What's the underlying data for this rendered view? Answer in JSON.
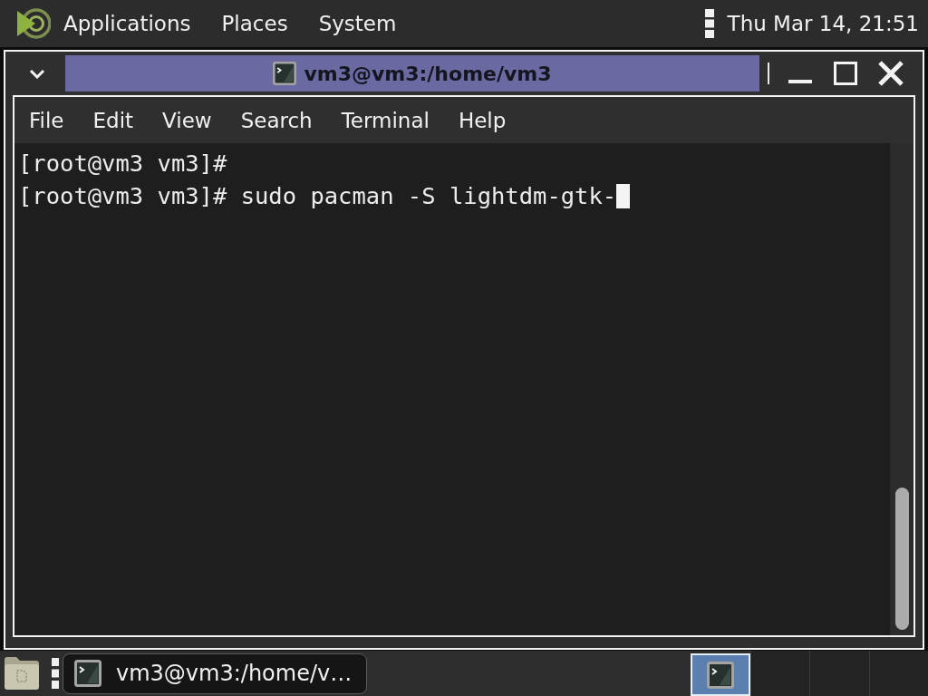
{
  "top_panel": {
    "menus": [
      {
        "label": "Applications"
      },
      {
        "label": "Places"
      },
      {
        "label": "System"
      }
    ],
    "clock": "Thu Mar 14, 21:51"
  },
  "window": {
    "title": "vm3@vm3:/home/vm3",
    "focused": true,
    "menu": [
      {
        "label": "File"
      },
      {
        "label": "Edit"
      },
      {
        "label": "View"
      },
      {
        "label": "Search"
      },
      {
        "label": "Terminal"
      },
      {
        "label": "Help"
      }
    ],
    "terminal": {
      "lines": [
        {
          "text": "[root@vm3 vm3]#",
          "cursor": false
        },
        {
          "text": "[root@vm3 vm3]# sudo pacman -S lightdm-gtk-",
          "cursor": true
        }
      ]
    }
  },
  "taskbar": {
    "tasks": [
      {
        "label": "vm3@vm3:/home/v…"
      }
    ],
    "workspaces": [
      {
        "selected": true,
        "has_window": true
      },
      {
        "selected": false,
        "has_window": false
      },
      {
        "selected": false,
        "has_window": false
      },
      {
        "selected": false,
        "has_window": false
      }
    ]
  }
}
